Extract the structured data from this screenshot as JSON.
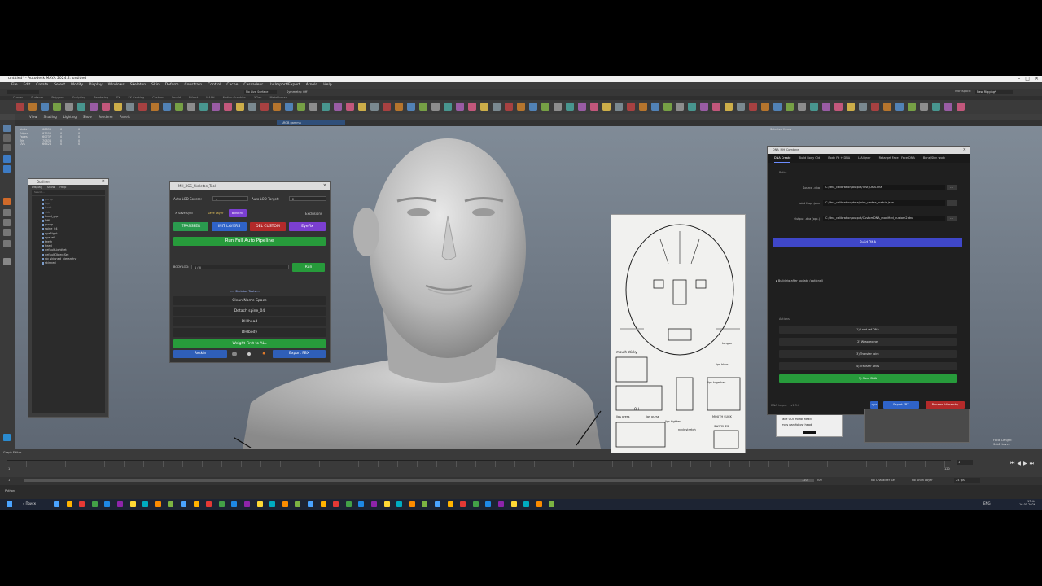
{
  "window": {
    "title": "untitled* - Autodesk MAYA 2024.2: untitled"
  },
  "menubar": [
    "File",
    "Edit",
    "Create",
    "Select",
    "Modify",
    "Display",
    "Windows",
    "Skeleton",
    "Skin",
    "Deform",
    "Constrain",
    "Control",
    "Cache",
    "Cascadeur",
    "Uv Import/Export",
    "Arnold",
    "Help"
  ],
  "statusline": {
    "workspace_label": "Workspace:",
    "workspace_value": "New Rigging*",
    "no_live_surface": "No Live Surface",
    "symmetry": "Symmetry: Off"
  },
  "shelf_tabs": [
    "Curves",
    "Surfaces",
    "Polygons",
    "Sculpting",
    "Rendering",
    "FX",
    "FX Caching",
    "Custom",
    "Arnold",
    "Bifrost",
    "MASH",
    "Motion Graphics",
    "XGen",
    "MetaHuman"
  ],
  "panel_menu": [
    "View",
    "Shading",
    "Lighting",
    "Show",
    "Renderer",
    "Panels"
  ],
  "viewport": {
    "hud": [
      {
        "label": "Verts",
        "a": "68895",
        "b": "0",
        "c": "0"
      },
      {
        "label": "Edges",
        "a": "67990",
        "b": "0",
        "c": "0"
      },
      {
        "label": "Faces",
        "a": "60737",
        "b": "0",
        "c": "0"
      },
      {
        "label": "Tris",
        "a": "70834",
        "b": "0",
        "c": "0"
      },
      {
        "label": "UVs",
        "a": "66424",
        "b": "0",
        "c": "0"
      }
    ],
    "colorspace": "sRGB gamma",
    "selected_items": "Selected Items",
    "persp": "persp",
    "focal_label": "Focal Length:",
    "subd_label": "SubD Level:"
  },
  "outliner": {
    "title": "Outliner",
    "menu": [
      "Display",
      "Show",
      "Help"
    ],
    "search_placeholder": "Search...",
    "items": [
      "persp",
      "top",
      "front",
      "side",
      "head_grp",
      "DHI",
      "group",
      "spine_04",
      "eyeRight",
      "eyeLeft",
      "teeth",
      "head",
      "defaultLightSet",
      "defaultObjectSet",
      "rig_skinned_hierarchy",
      "skinned"
    ]
  },
  "mh_tool": {
    "title": "MH_XGS_Skeleton_Tool",
    "auto_lod_source_label": "Auto LOD Source:",
    "auto_lod_source_value": "4",
    "auto_lod_target_label": "Auto LOD Target:",
    "auto_lod_target_value": "2",
    "save_sync": "Save Sync",
    "save_layer": "Save Layer",
    "blink_fix": "Blink Fix",
    "exclusions": "Exclusions",
    "transfer": "TRANSFER",
    "init_layers": "INIT LAYERS",
    "del_custom": "DEL CUSTOM",
    "eyefix": "EyeFix",
    "run_full": "Run Full Auto Pipeline",
    "body_lod_label": "BODY LOD:",
    "body_lod_value": "1 (3)",
    "run": "Run",
    "skeleton_tools": "---- Skeleton Tools ----",
    "clean_name_space": "Clean Name Space",
    "detach_spine": "Detach spine_04",
    "dhihead": "DHIhead",
    "dhibody": "DHIbody",
    "weight_first": "Weight First to ALL",
    "reskin": "Reskin",
    "export_fbx": "Export FBX"
  },
  "dna_tool": {
    "title": "DNA_MH_Combine",
    "tabs": [
      "DNA Create",
      "Build Body Old",
      "Body Fit + DNA",
      "L Aligner",
      "Retarget Face | Face DNA",
      "Bone/Skin work"
    ],
    "paths_label": "Paths",
    "fields": [
      {
        "label": "Source .dna",
        "value": "C:/dna_calibration/output/Test_DNA.dna"
      },
      {
        "label": "Joint Map .json",
        "value": "C:/dna_calibration/data/joint_vertex_matrix.json"
      },
      {
        "label": "Output .dna (opt.)",
        "value": "C:/dna_calibration/output/CustomDNA_modified_custom2.dna"
      }
    ],
    "browse": "...",
    "build_dna": "Build DNA",
    "build_rig": "Build rig after update (optional)",
    "actions_label": "Actions",
    "actions": [
      "1) Load ref DNA",
      "2) Wrap extras",
      "3) Transfer Joint",
      "4) Transfer Attrs",
      "5) Save DNA"
    ],
    "footer": "DNA helper • v1.3.0",
    "btn_small": "light",
    "export_fbx": "Export FBX",
    "rename_hierarchy": "Rename Hierarchy"
  },
  "reference_sheet": {
    "labels": [
      "mouth sticky",
      "tongue",
      "lips blow",
      "lips together",
      "OH",
      "lips press",
      "lips purse",
      "lips tighten",
      "MOUTH SUCK",
      "neck stretch",
      "SWITCHES"
    ],
    "eye_labels": [
      "face GUI mirror head",
      "eyes pan follow head"
    ]
  },
  "timeline": {
    "start": "1",
    "end": "120",
    "range_start": "1",
    "range_end": "120",
    "playback_start": "1",
    "playback_end": "200",
    "no_character_set": "No Character Set",
    "no_anim_layer": "No Anim Layer",
    "fps": "24 fps"
  },
  "cmdline": {
    "label": "Python",
    "graph_editor": "Graph Editor"
  },
  "taskbar": {
    "search": "Поиск",
    "lang": "ENG",
    "time": "17:44",
    "date": "16.01.2026"
  }
}
